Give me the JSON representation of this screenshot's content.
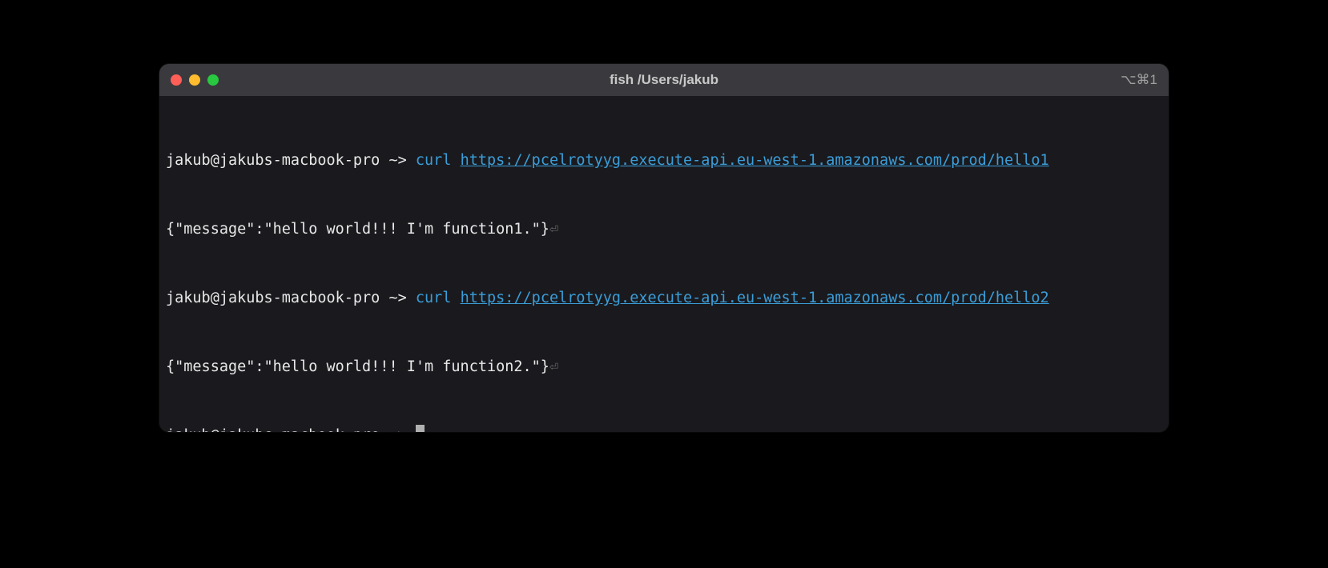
{
  "window": {
    "title": "fish /Users/jakub",
    "tab_label": "⌥⌘1"
  },
  "prompt": {
    "user_host": "jakub@jakubs-macbook-pro",
    "path": "~",
    "arrow": ">"
  },
  "lines": [
    {
      "command": "curl",
      "url": "https://pcelrotyyg.execute-api.eu-west-1.amazonaws.com/prod/hello1",
      "output": "{\"message\":\"hello world!!! I'm function1.\"}",
      "return_symbol": "⏎"
    },
    {
      "command": "curl",
      "url": "https://pcelrotyyg.execute-api.eu-west-1.amazonaws.com/prod/hello2",
      "output": "{\"message\":\"hello world!!! I'm function2.\"}",
      "return_symbol": "⏎"
    }
  ]
}
